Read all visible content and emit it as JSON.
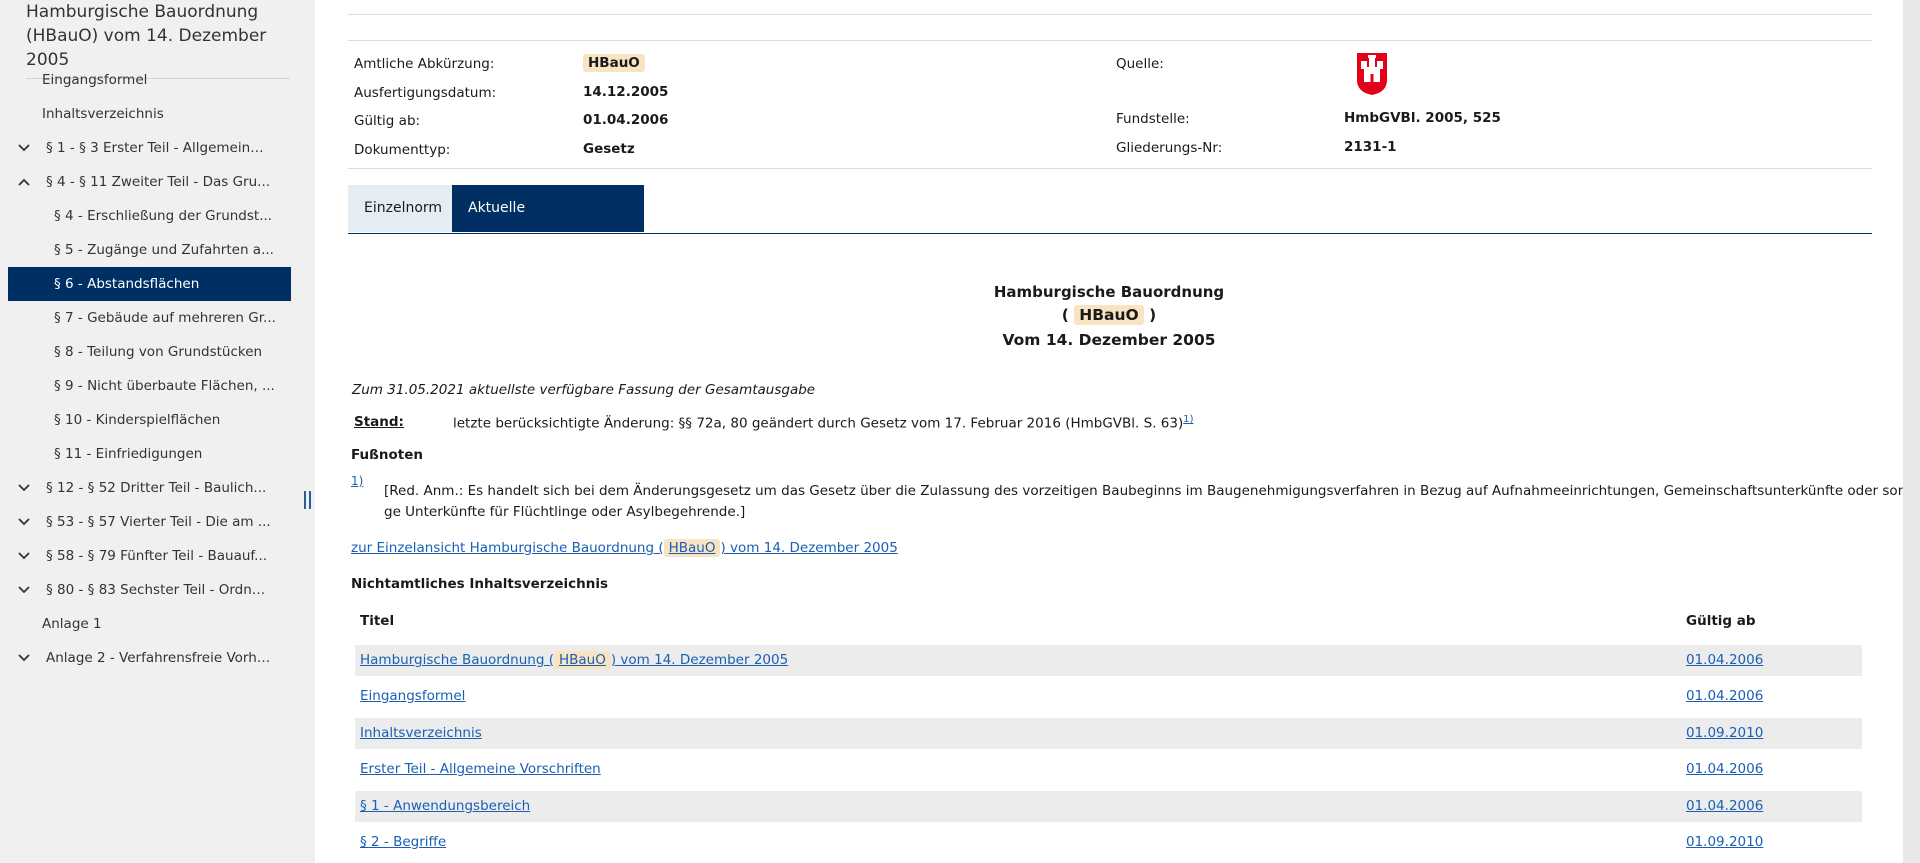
{
  "sidebar": {
    "doc_title": "Hamburgische Bauordnung (HBauO) vom 14. Dezember 2005",
    "items": [
      {
        "label": "Eingangsformel"
      },
      {
        "label": "Inhaltsverzeichnis"
      },
      {
        "label": "§ 1 - § 3 Erster Teil - Allgemeine ..."
      },
      {
        "label": "§ 4 - § 11 Zweiter Teil - Das Gru..."
      },
      {
        "label": "§ 4 - Erschließung der Grundst..."
      },
      {
        "label": "§ 5 - Zugänge und Zufahrten a..."
      },
      {
        "label": "§ 6 - Abstandsflächen"
      },
      {
        "label": "§ 7 - Gebäude auf mehreren Gr..."
      },
      {
        "label": "§ 8 - Teilung von Grundstücken"
      },
      {
        "label": "§ 9 - Nicht überbaute Flächen, ..."
      },
      {
        "label": "§ 10 - Kinderspielflächen"
      },
      {
        "label": "§ 11 - Einfriedigungen"
      },
      {
        "label": "§ 12 - § 52 Dritter Teil - Baulich..."
      },
      {
        "label": "§ 53 - § 57 Vierter Teil - Die am ..."
      },
      {
        "label": "§ 58 - § 79 Fünfter Teil - Bauauf..."
      },
      {
        "label": "§ 80 - § 83 Sechster Teil - Ordnu..."
      },
      {
        "label": "Anlage 1"
      },
      {
        "label": "Anlage 2 - Verfahrensfreie Vorha..."
      }
    ]
  },
  "meta": {
    "abk_label": "Amtliche Abkürzung:",
    "abk_value": "HBauO",
    "ausf_label": "Ausfertigungsdatum:",
    "ausf_value": "14.12.2005",
    "gueltig_label": "Gültig ab:",
    "gueltig_value": "01.04.2006",
    "typ_label": "Dokumenttyp:",
    "typ_value": "Gesetz",
    "quelle_label": "Quelle:",
    "fund_label": "Fundstelle:",
    "fund_value": "HmbGVBl. 2005, 525",
    "glied_label": "Gliederungs-Nr:",
    "glied_value": "2131-1"
  },
  "tabs": {
    "einzelnorm": "Einzelnorm",
    "gesamtausgabe": "Aktuelle Gesamtausgabe"
  },
  "heading": {
    "line1": "Hamburgische Bauordnung",
    "open_paren": "(",
    "abbr": "HBauO",
    "close_paren": ")",
    "line3": "Vom 14. Dezember 2005"
  },
  "body": {
    "fassung": "Zum 31.05.2021 aktuellste verfügbare Fassung der Gesamtausgabe",
    "stand_label": "Stand:",
    "stand_text": "letzte berücksichtigte Änderung: §§ 72a, 80 geändert durch Gesetz vom 17. Februar 2016 (HmbGVBl. S. 63)",
    "stand_sup": "1)",
    "fussnoten_title": "Fußnoten",
    "fn_marker": "1)",
    "fn_line1": "[Red. Anm.: Es handelt sich bei dem Änderungsgesetz um das Gesetz über die Zulassung des vorzeitigen Baubeginns im Baugenehmigungsverfahren in Bezug auf Aufnahmeeinrichtungen, Gemeinschaftsunterkünfte oder sonsti-",
    "fn_line2": "ge Unterkünfte für Flüchtlinge oder Asylbegehrende.]",
    "einzel_link_pre": "zur Einzelansicht Hamburgische Bauordnung (",
    "einzel_link_abbr": "HBauO",
    "einzel_link_post": ") vom 14. Dezember 2005",
    "toc_title": "Nichtamtliches Inhaltsverzeichnis"
  },
  "toc": {
    "col_title": "Titel",
    "col_date": "Gültig ab",
    "row0_pre": "Hamburgische Bauordnung (",
    "row0_abbr": "HBauO",
    "row0_post": ") vom 14. Dezember 2005",
    "row0_date": "01.04.2006",
    "rows": [
      {
        "title": "Eingangsformel",
        "date": "01.04.2006"
      },
      {
        "title": "Inhaltsverzeichnis",
        "date": "01.09.2010"
      },
      {
        "title": "Erster Teil - Allgemeine Vorschriften",
        "date": "01.04.2006"
      },
      {
        "title": "§ 1 - Anwendungsbereich",
        "date": "01.04.2006"
      },
      {
        "title": "§ 2 - Begriffe",
        "date": "01.09.2010"
      }
    ]
  },
  "colors": {
    "accent": "#003063",
    "link": "#1a5fb4",
    "highlight": "#f8e3c2"
  }
}
